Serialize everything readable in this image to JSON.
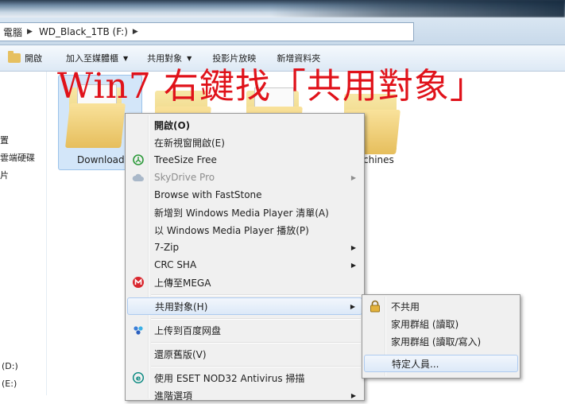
{
  "address": {
    "crumbs": [
      "電腦",
      "WD_Black_1TB (F:)"
    ]
  },
  "toolbar": {
    "open": "開啟",
    "add_to_library": "加入至媒體櫃",
    "share_with": "共用對象",
    "slideshow": "投影片放映",
    "new_folder": "新增資料夾"
  },
  "nav": {
    "item1": "置",
    "item2": "雲端硬碟",
    "item3": "片",
    "drive_d": "(D:)",
    "drive_e": "(E:)"
  },
  "folders": {
    "downloads": "Download",
    "machines": "chines"
  },
  "overlay": {
    "title": "Win7 右鍵找「共用對象」"
  },
  "context_menu": {
    "items": [
      {
        "label": "開啟(O)"
      },
      {
        "label": "在新視窗開啟(E)"
      },
      {
        "label": "TreeSize Free"
      },
      {
        "label": "SkyDrive Pro"
      },
      {
        "label": "Browse with FastStone"
      },
      {
        "label": "新增到 Windows Media Player 清單(A)"
      },
      {
        "label": "以 Windows Media Player 播放(P)"
      },
      {
        "label": "7-Zip"
      },
      {
        "label": "CRC SHA"
      },
      {
        "label": "上傳至MEGA"
      },
      {
        "label": "共用對象(H)"
      },
      {
        "label": "上传到百度网盘"
      },
      {
        "label": "還原舊版(V)"
      },
      {
        "label": "使用 ESET NOD32 Antivirus 掃描"
      },
      {
        "label": "進階選項"
      }
    ]
  },
  "share_submenu": {
    "items": [
      {
        "label": "不共用"
      },
      {
        "label": "家用群組 (讀取)"
      },
      {
        "label": "家用群組 (讀取/寫入)"
      },
      {
        "label": "特定人員..."
      }
    ]
  },
  "colors": {
    "overlay_red": "#e0121a",
    "highlight": "#dce9f8"
  },
  "icons": {
    "treesize": "treesize-icon",
    "skydrive": "cloud-icon",
    "mega": "mega-icon",
    "baidu": "baidu-icon",
    "eset": "eset-icon",
    "lock": "lock-icon"
  }
}
